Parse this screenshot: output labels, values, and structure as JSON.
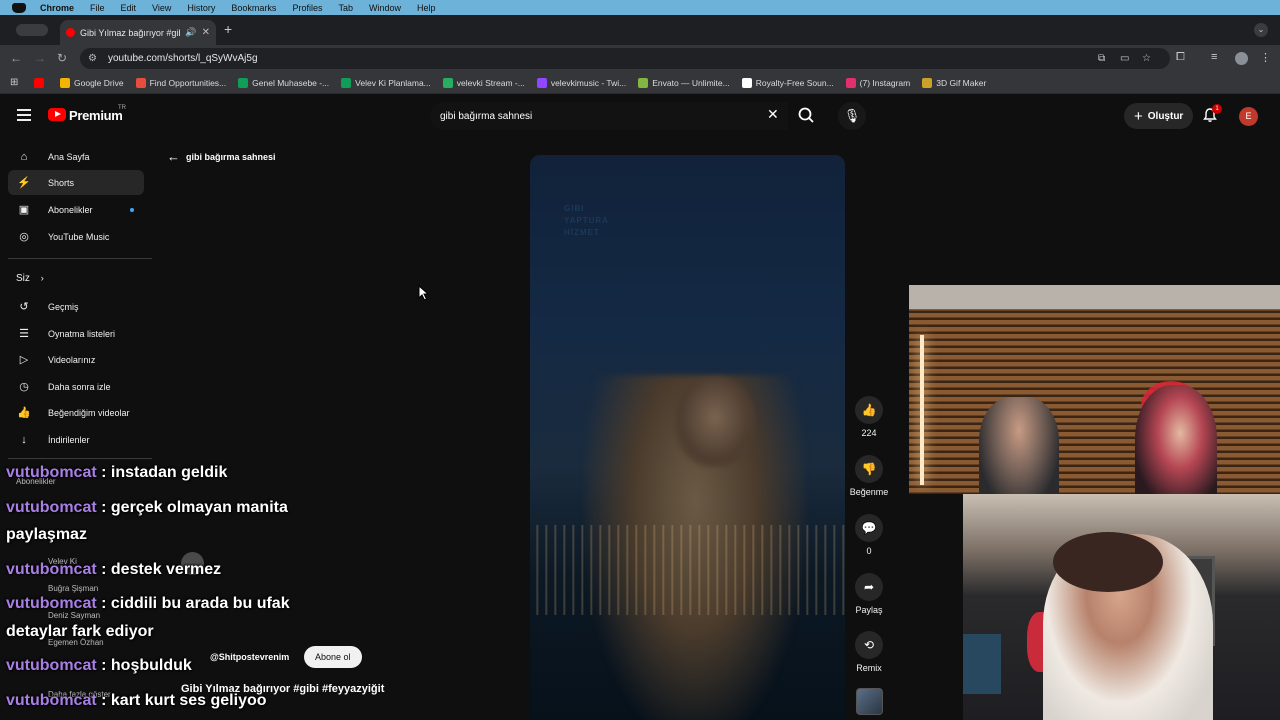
{
  "mac_menubar": {
    "items": [
      "Chrome",
      "File",
      "Edit",
      "View",
      "History",
      "Bookmarks",
      "Profiles",
      "Tab",
      "Window",
      "Help"
    ]
  },
  "browser": {
    "tab_title": "Gibi Yılmaz bağırıyor #gibi",
    "url": "youtube.com/shorts/l_qSyWvAj5g",
    "bookmarks": [
      {
        "label": "Google Drive",
        "color": "#f4b400"
      },
      {
        "label": "Find Opportunities...",
        "color": "#e74c3c"
      },
      {
        "label": "Genel Muhasebe -...",
        "color": "#0f9d58"
      },
      {
        "label": "Velev Ki Planlama...",
        "color": "#0f9d58"
      },
      {
        "label": "velevki Stream -...",
        "color": "#27ae60"
      },
      {
        "label": "velevkimusic - Twi...",
        "color": "#9146ff"
      },
      {
        "label": "Envato — Unlimite...",
        "color": "#82b541"
      },
      {
        "label": "Royalty-Free Soun...",
        "color": "#ffffff"
      },
      {
        "label": "(7) Instagram",
        "color": "#e1306c"
      },
      {
        "label": "3D Gif Maker",
        "color": "#c9a227"
      }
    ]
  },
  "youtube": {
    "brand": "Premium",
    "region": "TR",
    "search_value": "gibi bağırma sahnesi",
    "create_label": "Oluştur",
    "notification_count": "1",
    "avatar_letter": "E",
    "sidebar": {
      "main": [
        {
          "label": "Ana Sayfa",
          "icon": "home-icon"
        },
        {
          "label": "Shorts",
          "icon": "shorts-icon"
        },
        {
          "label": "Abonelikler",
          "icon": "subscriptions-icon"
        },
        {
          "label": "YouTube Music",
          "icon": "music-icon"
        }
      ],
      "you_section": "Siz",
      "you": [
        {
          "label": "Geçmiş",
          "icon": "history-icon"
        },
        {
          "label": "Oynatma listeleri",
          "icon": "playlist-icon"
        },
        {
          "label": "Videolarınız",
          "icon": "your-videos-icon"
        },
        {
          "label": "Daha sonra izle",
          "icon": "watch-later-icon"
        },
        {
          "label": "Beğendiğim videolar",
          "icon": "liked-icon"
        },
        {
          "label": "İndirilenler",
          "icon": "download-icon"
        }
      ],
      "subscriptions_heading": "Abonelikler",
      "subscriptions": [
        "Velev Ki",
        "Buğra Şişman",
        "Deniz Sayman",
        "Egemen Özhan"
      ],
      "show_more": "Daha fazla göster"
    },
    "shorts": {
      "query": "gibi bağırma sahnesi",
      "watermark_lines": [
        "GIBI",
        "YAPTURA",
        "HİZMET"
      ],
      "likes": "224",
      "dislike_label": "Beğenme",
      "comments": "0",
      "share_label": "Paylaş",
      "remix_label": "Remix",
      "channel": "@Shitpostevrenim",
      "subscribe_label": "Abone ol",
      "title": "Gibi Yılmaz bağırıyor #gibi #feyyazyiğit"
    }
  },
  "chat": [
    {
      "user": "vutubomcat",
      "message": " : instadan geldik"
    },
    {
      "user": "vutubomcat",
      "message": " : gerçek olmayan manita"
    },
    {
      "user": "",
      "message": "paylaşmaz"
    },
    {
      "user": "vutubomcat",
      "message": " : destek vermez"
    },
    {
      "user": "vutubomcat",
      "message": " : ciddili bu arada bu ufak"
    },
    {
      "user": "",
      "message": "detaylar fark ediyor"
    },
    {
      "user": "vutubomcat",
      "message": " : hoşbulduk"
    },
    {
      "user": "vutubomcat",
      "message": " : kart kurt ses geliyoo"
    }
  ]
}
